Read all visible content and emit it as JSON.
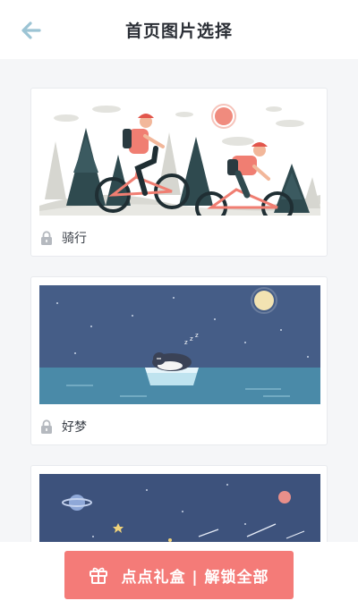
{
  "header": {
    "title": "首页图片选择",
    "back_icon": "arrow-left-icon",
    "back_color": "#9cc4d4"
  },
  "cards": [
    {
      "label": "骑行",
      "image": "cycling-illustration",
      "locked": true
    },
    {
      "label": "好梦",
      "image": "sleeping-penguin-illustration",
      "locked": true
    },
    {
      "label": "",
      "image": "space-illustration",
      "locked": true
    }
  ],
  "bottom": {
    "button_label": "点点礼盒 | 解锁全部",
    "button_icon": "gift-icon",
    "button_color": "#f47b78"
  },
  "colors": {
    "background": "#f5f6f8",
    "lock_icon": "#b5b9bf"
  }
}
